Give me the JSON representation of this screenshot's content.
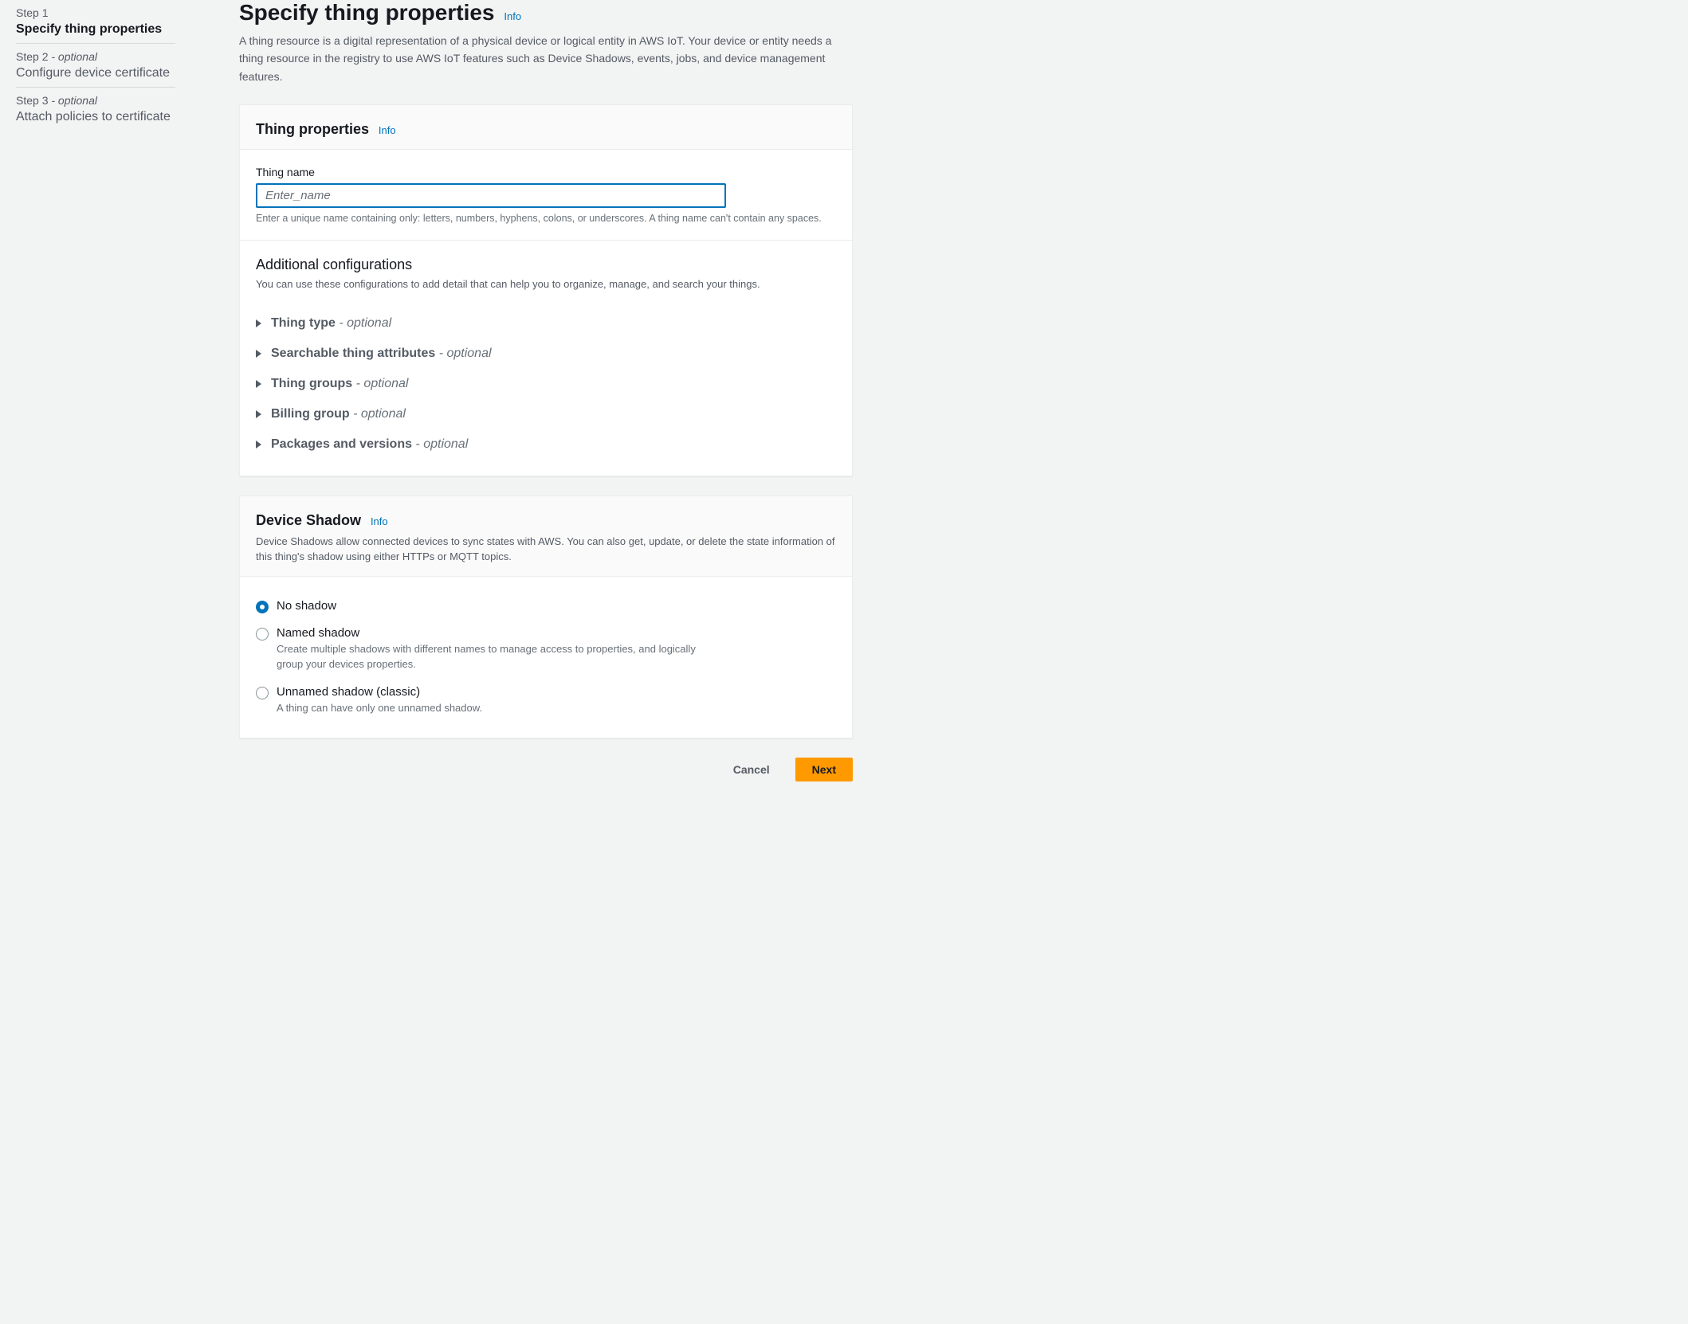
{
  "sidebar": {
    "steps": [
      {
        "number": "Step 1",
        "optional": "",
        "title": "Specify thing properties"
      },
      {
        "number": "Step 2",
        "optional": " - optional",
        "title": "Configure device certificate"
      },
      {
        "number": "Step 3",
        "optional": " - optional",
        "title": "Attach policies to certificate"
      }
    ]
  },
  "header": {
    "title": "Specify thing properties",
    "info": "Info",
    "desc": "A thing resource is a digital representation of a physical device or logical entity in AWS IoT. Your device or entity needs a thing resource in the registry to use AWS IoT features such as Device Shadows, events, jobs, and device management features."
  },
  "panel_props": {
    "title": "Thing properties",
    "info": "Info",
    "name_label": "Thing name",
    "name_placeholder": "Enter_name",
    "name_hint": "Enter a unique name containing only: letters, numbers, hyphens, colons, or underscores. A thing name can't contain any spaces.",
    "additional_title": "Additional configurations",
    "additional_desc": "You can use these configurations to add detail that can help you to organize, manage, and search your things.",
    "optional_suffix": " - optional",
    "expandables": [
      {
        "label": "Thing type"
      },
      {
        "label": "Searchable thing attributes"
      },
      {
        "label": "Thing groups"
      },
      {
        "label": "Billing group"
      },
      {
        "label": "Packages and versions"
      }
    ]
  },
  "panel_shadow": {
    "title": "Device Shadow",
    "info": "Info",
    "desc": "Device Shadows allow connected devices to sync states with AWS. You can also get, update, or delete the state information of this thing's shadow using either HTTPs or MQTT topics.",
    "options": [
      {
        "label": "No shadow",
        "desc": ""
      },
      {
        "label": "Named shadow",
        "desc": "Create multiple shadows with different names to manage access to properties, and logically group your devices properties."
      },
      {
        "label": "Unnamed shadow (classic)",
        "desc": "A thing can have only one unnamed shadow."
      }
    ]
  },
  "footer": {
    "cancel": "Cancel",
    "next": "Next"
  }
}
